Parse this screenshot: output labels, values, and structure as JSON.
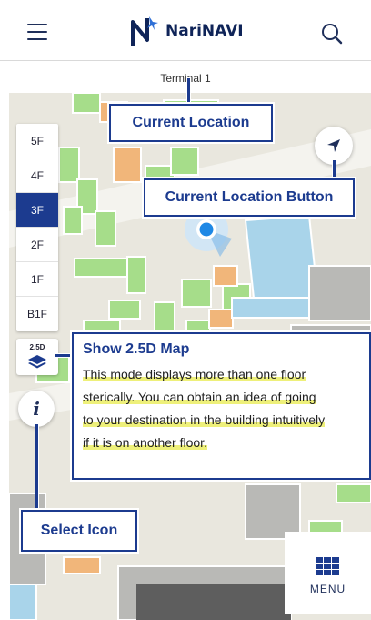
{
  "header": {
    "app_name": "NariNAVI",
    "menu_icon": "hamburger-icon",
    "search_icon": "search-icon"
  },
  "terminal": {
    "label": "Terminal 1"
  },
  "floors": [
    "5F",
    "4F",
    "3F",
    "2F",
    "1F",
    "B1F"
  ],
  "active_floor": "3F",
  "view_toggle": {
    "label": "2.5D",
    "icon": "layers-icon"
  },
  "info_button": {
    "label": "i"
  },
  "menu_button": {
    "label": "MENU",
    "icon": "grid-icon"
  },
  "callouts": {
    "current_location": "Current Location",
    "current_location_button": "Current Location Button",
    "select_icon": "Select Icon"
  },
  "show_25d": {
    "title": "Show 2.5D Map",
    "lines": [
      "This mode displays more than one floor",
      "sterically. You can obtain an idea of going",
      "to your destination in the building intuitively",
      "if it is on another floor."
    ]
  },
  "colors": {
    "accent": "#1c3b8f",
    "highlight": "#eef07a",
    "location_dot": "#1e88e5"
  }
}
